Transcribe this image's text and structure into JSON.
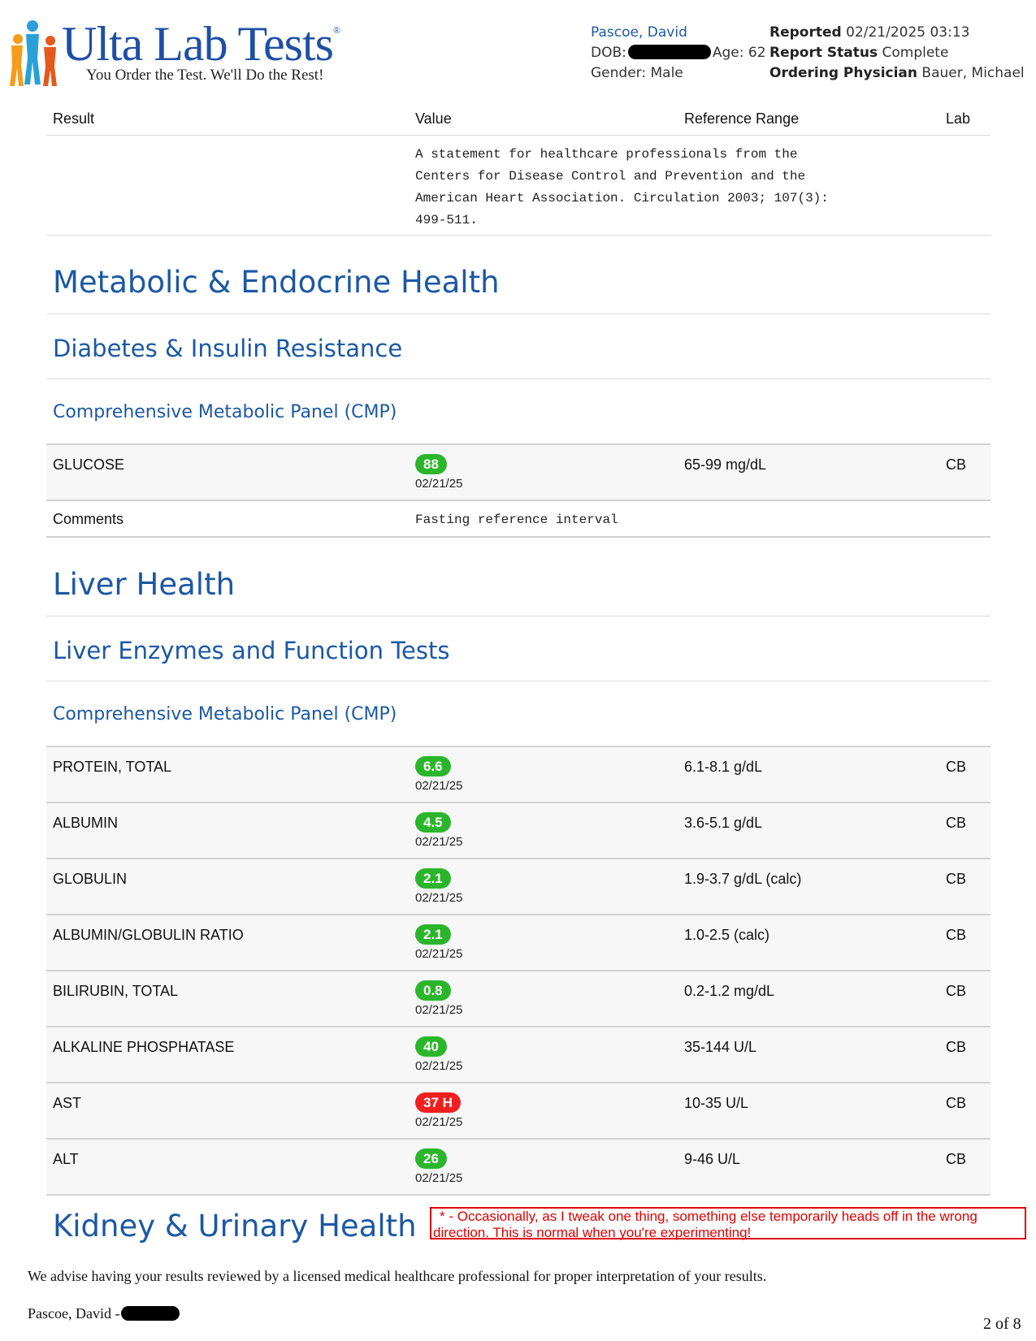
{
  "header": {
    "logo_title": "Ulta Lab Tests",
    "logo_tagline": "You Order the Test. We'll Do the Rest!",
    "patient_name": "Pascoe, David",
    "dob_label": "DOB:",
    "age_label": "Age:",
    "age_value": "62",
    "gender_label": "Gender:",
    "gender_value": "Male",
    "reported_label": "Reported",
    "reported_value": "02/21/2025 03:13",
    "status_label": "Report Status",
    "status_value": "Complete",
    "physician_label": "Ordering Physician",
    "physician_value": "Bauer, Michael"
  },
  "columns": {
    "result": "Result",
    "value": "Value",
    "reference": "Reference Range",
    "lab": "Lab"
  },
  "note": "A statement for healthcare professionals from the\nCenters for Disease Control and Prevention and the\nAmerican Heart Association. Circulation 2003; 107(3):\n499-511.",
  "sections": {
    "metabolic": "Metabolic & Endocrine Health",
    "diabetes": "Diabetes & Insulin Resistance",
    "cmp1": "Comprehensive Metabolic Panel (CMP)",
    "liver": "Liver Health",
    "liver_sub": "Liver Enzymes and Function Tests",
    "cmp2": "Comprehensive Metabolic Panel (CMP)",
    "kidney": "Kidney & Urinary Health"
  },
  "glucose": {
    "name": "GLUCOSE",
    "value": "88",
    "date": "02/21/25",
    "range": "65-99 mg/dL",
    "lab": "CB"
  },
  "comments": {
    "label": "Comments",
    "text": "Fasting reference interval"
  },
  "liver_results": [
    {
      "name": "PROTEIN, TOTAL",
      "value": "6.6",
      "date": "02/21/25",
      "range": "6.1-8.1 g/dL",
      "lab": "CB",
      "flag": "ok"
    },
    {
      "name": "ALBUMIN",
      "value": "4.5",
      "date": "02/21/25",
      "range": "3.6-5.1 g/dL",
      "lab": "CB",
      "flag": "ok"
    },
    {
      "name": "GLOBULIN",
      "value": "2.1",
      "date": "02/21/25",
      "range": "1.9-3.7 g/dL (calc)",
      "lab": "CB",
      "flag": "ok"
    },
    {
      "name": "ALBUMIN/GLOBULIN RATIO",
      "value": "2.1",
      "date": "02/21/25",
      "range": "1.0-2.5 (calc)",
      "lab": "CB",
      "flag": "ok"
    },
    {
      "name": "BILIRUBIN, TOTAL",
      "value": "0.8",
      "date": "02/21/25",
      "range": "0.2-1.2 mg/dL",
      "lab": "CB",
      "flag": "ok"
    },
    {
      "name": "ALKALINE PHOSPHATASE",
      "value": "40",
      "date": "02/21/25",
      "range": "35-144 U/L",
      "lab": "CB",
      "flag": "ok"
    },
    {
      "name": "AST",
      "value": "37 H",
      "date": "02/21/25",
      "range": "10-35 U/L",
      "lab": "CB",
      "flag": "hi"
    },
    {
      "name": "ALT",
      "value": "26",
      "date": "02/21/25",
      "range": "9-46 U/L",
      "lab": "CB",
      "flag": "ok"
    }
  ],
  "warning": " * - Occasionally, as I tweak one thing, something else temporarily heads off in the wrong direction. This is normal when you're experimenting!",
  "footer": {
    "advice": "We advise having your results reviewed by a licensed medical healthcare professional for proper interpretation of your results.",
    "name": "Pascoe, David -",
    "page": "2 of 8"
  },
  "colors": {
    "brand_blue": "#1c58a4",
    "normal": "#2bb52b",
    "high": "#f21f1f",
    "warning": "#e00000"
  },
  "icons": {
    "logo": "people-figures-logo-icon"
  }
}
